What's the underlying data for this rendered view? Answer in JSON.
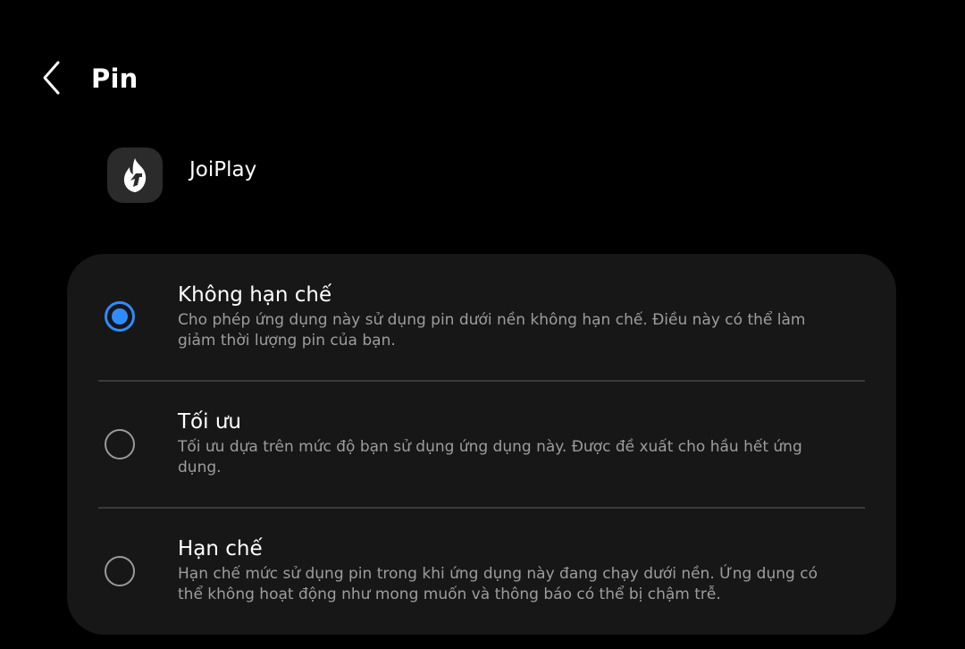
{
  "header": {
    "title": "Pin",
    "back_icon": "chevron-left-icon"
  },
  "app": {
    "name": "JoiPlay",
    "icon": "flame-app-icon"
  },
  "options": [
    {
      "title": "Không hạn chế",
      "description": "Cho phép ứng dụng này sử dụng pin dưới nền không hạn chế. Điều này có thể làm giảm thời lượng pin của bạn.",
      "selected": true
    },
    {
      "title": "Tối ưu",
      "description": "Tối ưu dựa trên mức độ bạn sử dụng ứng dụng này. Được đề xuất cho hầu hết ứng dụng.",
      "selected": false
    },
    {
      "title": "Hạn chế",
      "description": "Hạn chế mức sử dụng pin trong khi ứng dụng này đang chạy dưới nền. Ứng dụng có thể không hoạt động như mong muốn và thông báo có thể bị chậm trễ.",
      "selected": false
    }
  ],
  "colors": {
    "background": "#000000",
    "card": "#171717",
    "accent": "#2f8cff",
    "secondary_text": "#9d9d9d"
  }
}
